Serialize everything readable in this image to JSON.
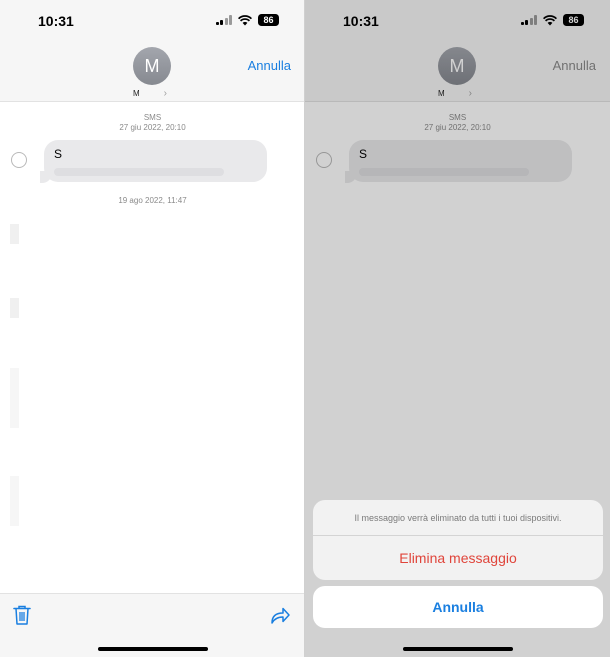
{
  "status": {
    "time": "10:31",
    "battery": "86"
  },
  "contact": {
    "initial": "M",
    "name": "M",
    "chevron": "›"
  },
  "nav": {
    "cancel_label": "Annulla"
  },
  "thread": {
    "service": "SMS",
    "timestamp1": "27 giu 2022, 20:10",
    "message_text": "S",
    "timestamp2": "19 ago 2022, 11:47"
  },
  "action_sheet": {
    "message": "Il messaggio verrà eliminato da tutti i tuoi dispositivi.",
    "delete_label": "Elimina messaggio",
    "cancel_label": "Annulla"
  },
  "icons": {
    "trash": "trash-icon",
    "share": "share-icon",
    "signal": "cellular-signal-icon",
    "wifi": "wifi-icon",
    "battery": "battery-icon"
  },
  "colors": {
    "accent_blue": "#1a7fe0",
    "destructive_red": "#e0453b",
    "bubble_gray": "#e9e9eb"
  }
}
